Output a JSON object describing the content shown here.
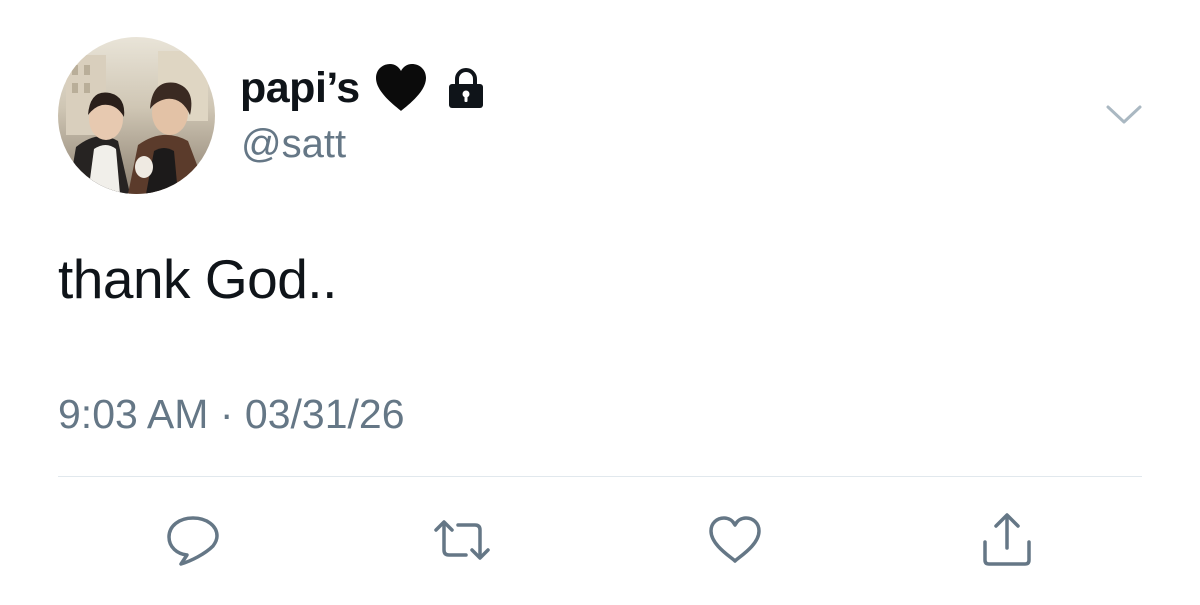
{
  "user": {
    "display_name": "papi’s",
    "handle": "@satt",
    "avatar_icon": "profile-photo",
    "name_emoji_icon": "black-heart-icon",
    "protected_icon": "lock-icon"
  },
  "tweet": {
    "text": "thank God..",
    "time": "9:03 AM",
    "separator": "·",
    "date": "03/31/26"
  },
  "header": {
    "menu_icon": "chevron-down-icon"
  },
  "actions": [
    {
      "name": "reply",
      "icon": "comment-bubble-icon"
    },
    {
      "name": "retweet",
      "icon": "retweet-arrows-icon"
    },
    {
      "name": "like",
      "icon": "heart-outline-icon"
    },
    {
      "name": "share",
      "icon": "share-upload-icon"
    }
  ],
  "colors": {
    "text_primary": "#0f1419",
    "text_secondary": "#657786",
    "icon_gray": "#657786",
    "divider": "#e1e8ed",
    "background": "#ffffff"
  }
}
